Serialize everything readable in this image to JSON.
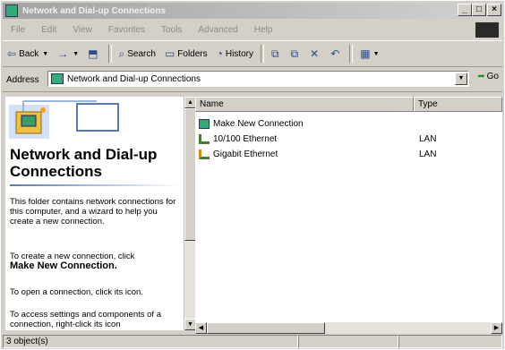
{
  "window": {
    "title": "Network and Dial-up Connections",
    "controls": {
      "minimize": "_",
      "maximize": "□",
      "close": "×"
    }
  },
  "menu": [
    "File",
    "Edit",
    "View",
    "Favorites",
    "Tools",
    "Advanced",
    "Help"
  ],
  "toolbar": {
    "back": "Back",
    "forward_arrow": "→",
    "search": "Search",
    "folders": "Folders",
    "history": "History"
  },
  "address": {
    "label": "Address",
    "value": "Network and Dial-up Connections",
    "go": "Go"
  },
  "left_pane": {
    "title": "Network and Dial-up Connections",
    "description": "This folder contains network connections for this computer, and a wizard to help you create a new connection.",
    "create_prefix": "To create a new connection, click",
    "create_link": "Make New Connection.",
    "open_text": "To open a connection, click its icon.",
    "settings_text": "To access settings and components of a connection, right-click its icon"
  },
  "list": {
    "columns": [
      "Name",
      "Type"
    ],
    "rows": [
      {
        "name": "Make New Connection",
        "type": "",
        "icon": "wizard-icon"
      },
      {
        "name": "10/100 Ethernet",
        "type": "LAN",
        "icon": "network-connection-icon"
      },
      {
        "name": "Gigabit Ethernet",
        "type": "LAN",
        "icon": "network-connection-icon"
      }
    ]
  },
  "status": {
    "text": "3 object(s)"
  },
  "colors": {
    "title_bar": "#a3a3a3",
    "face": "#d4d0c8",
    "left_pane_bg": "#ffffff",
    "accent": "#5a79b8"
  }
}
